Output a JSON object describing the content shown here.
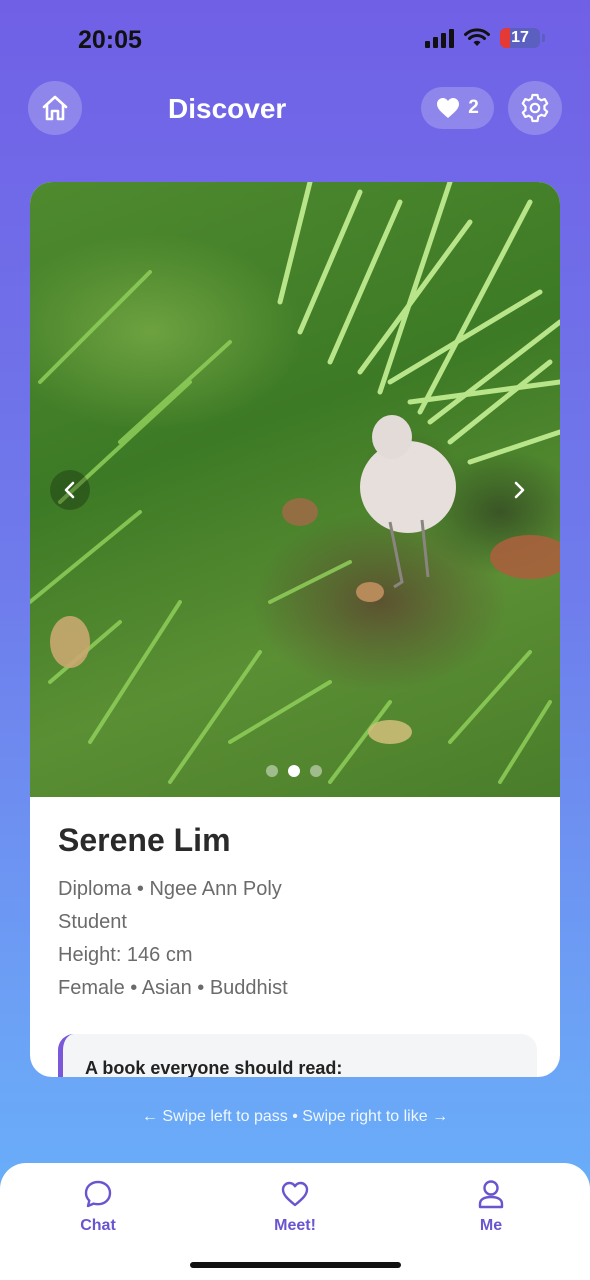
{
  "status": {
    "time": "20:05",
    "battery": "17"
  },
  "header": {
    "title": "Discover",
    "likes_count": "2"
  },
  "icons": {
    "home": "home-icon",
    "heart": "heart-icon",
    "settings": "gear-icon",
    "prev": "chevron-left-icon",
    "next": "chevron-right-icon"
  },
  "colors": {
    "accent": "#6A54D0",
    "gradient_top": "#7060E6",
    "gradient_bottom": "#66B2FA"
  },
  "profile": {
    "name": "Serene Lim",
    "education": "Diploma • Ngee Ann Poly",
    "occupation": "Student",
    "height": "Height: 146 cm",
    "details": "Female • Asian • Buddhist",
    "prompt_label": "A book everyone should read:",
    "photo_index": 2,
    "photo_count": 3
  },
  "swipe_hint": "← Swipe left to pass • Swipe right to like →",
  "tabs": [
    {
      "label": "Chat",
      "icon": "chat-bubble-icon"
    },
    {
      "label": "Meet!",
      "icon": "heart-outline-icon"
    },
    {
      "label": "Me",
      "icon": "person-icon"
    }
  ]
}
